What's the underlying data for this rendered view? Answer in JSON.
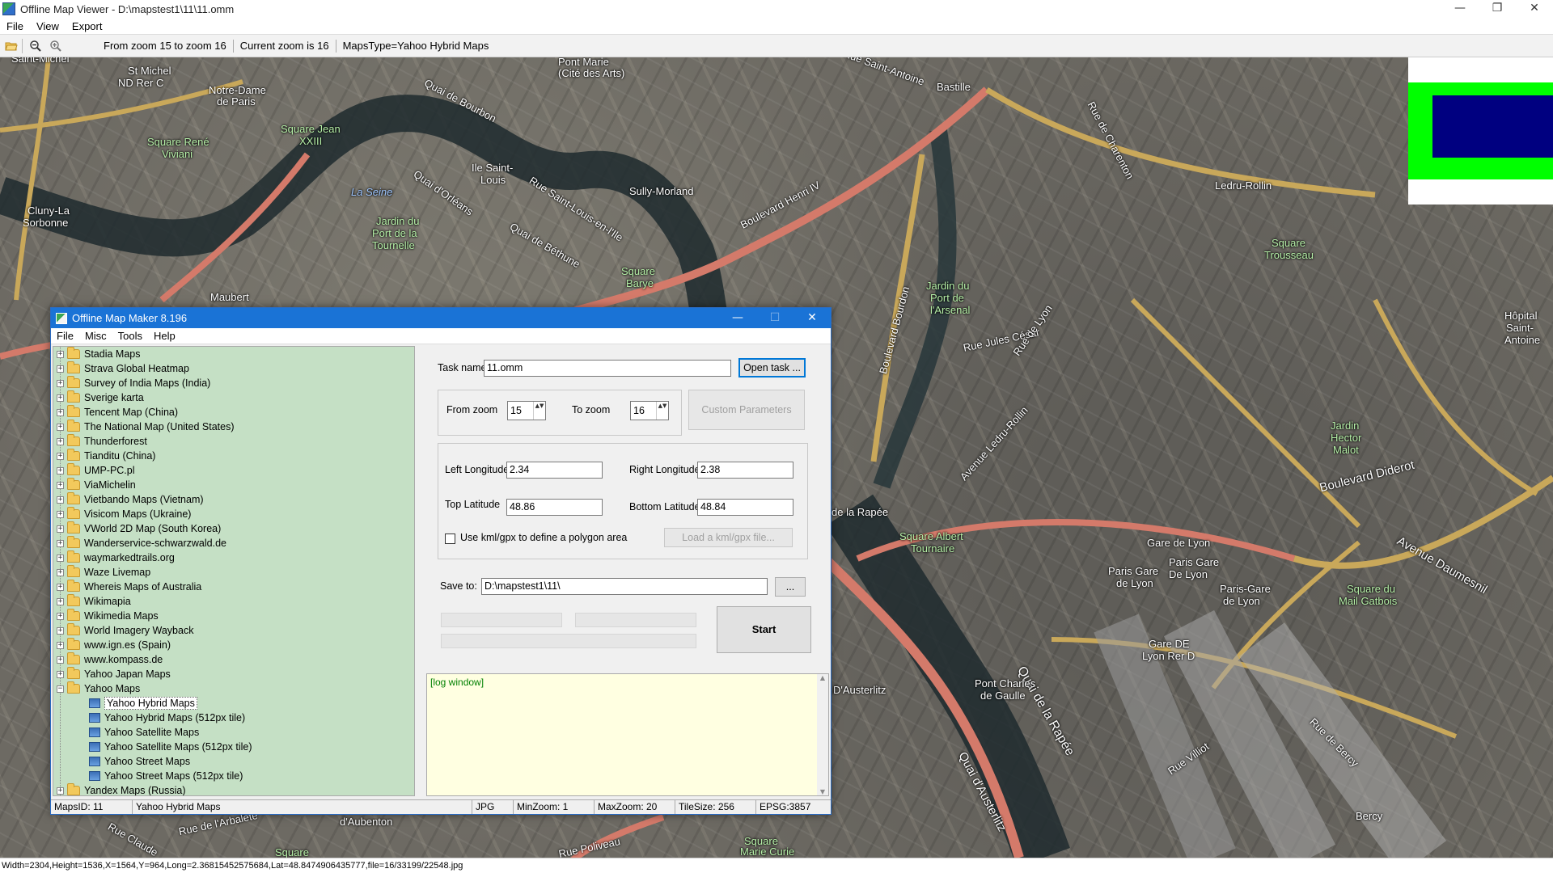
{
  "window": {
    "title": "Offline Map Viewer - D:\\mapstest1\\11\\11.omm",
    "controls": {
      "minimize": "—",
      "maximize": "❐",
      "close": "✕"
    }
  },
  "menu": [
    "File",
    "View",
    "Export"
  ],
  "toolbar": {
    "icons": [
      "open-folder-icon",
      "zoom-out-icon",
      "zoom-in-icon"
    ],
    "zoom_range": "From zoom 15 to zoom 16",
    "current_zoom": "Current zoom is 16",
    "maps_type": "MapsType=Yahoo Hybrid Maps"
  },
  "map_labels": [
    {
      "text": "Saint-Michel"
    },
    {
      "text": "St Michel"
    },
    {
      "text": "ND Rer C"
    },
    {
      "text": "Notre-Dame"
    },
    {
      "text": "de Paris"
    },
    {
      "text": "Square René"
    },
    {
      "text": "Viviani"
    },
    {
      "text": "Square Jean"
    },
    {
      "text": "XXIII"
    },
    {
      "text": "La Seine"
    },
    {
      "text": "Ile Saint-"
    },
    {
      "text": "Louis"
    },
    {
      "text": "Quai de Bourbon"
    },
    {
      "text": "Quai d'Orléans"
    },
    {
      "text": "Rue Saint-Louis-en-l'Ile"
    },
    {
      "text": "Pont Marie"
    },
    {
      "text": "(Cité des Arts)"
    },
    {
      "text": "Sully-Morland"
    },
    {
      "text": "Jardin du"
    },
    {
      "text": "Port de la"
    },
    {
      "text": "Tournelle"
    },
    {
      "text": "Quai de Béthune"
    },
    {
      "text": "Square"
    },
    {
      "text": "Barye"
    },
    {
      "text": "Cluny-La"
    },
    {
      "text": "Sorbonne"
    },
    {
      "text": "Maubert"
    },
    {
      "text": "Boulevard Henri IV"
    },
    {
      "text": "Bastille"
    },
    {
      "text": "Rue Saint-Antoine"
    },
    {
      "text": "Boulevard Bourdon"
    },
    {
      "text": "Jardin du"
    },
    {
      "text": "Port de"
    },
    {
      "text": "l'Arsenal"
    },
    {
      "text": "Rue Jules César"
    },
    {
      "text": "Rue de Lyon"
    },
    {
      "text": "Ledru-Rollin"
    },
    {
      "text": "Square"
    },
    {
      "text": "Trousseau"
    },
    {
      "text": "Rue de Charenton"
    },
    {
      "text": "Hôpital"
    },
    {
      "text": "Saint-"
    },
    {
      "text": "Antoine"
    },
    {
      "text": "Jardin"
    },
    {
      "text": "Hector"
    },
    {
      "text": "Malot"
    },
    {
      "text": "Boulevard Diderot"
    },
    {
      "text": "Avenue Ledru-Rollin"
    },
    {
      "text": "Avenue Daumesnil"
    },
    {
      "text": "Gare de Lyon"
    },
    {
      "text": "Paris Gare"
    },
    {
      "text": "de Lyon"
    },
    {
      "text": "Paris Gare"
    },
    {
      "text": "De Lyon"
    },
    {
      "text": "Paris-Gare"
    },
    {
      "text": "de Lyon"
    },
    {
      "text": "Square du"
    },
    {
      "text": "Mail Gatbois"
    },
    {
      "text": "Gare DE"
    },
    {
      "text": "Lyon Rer D"
    },
    {
      "text": "Quai de la Rapée"
    },
    {
      "text": "de la Rapée"
    },
    {
      "text": "Square Albert"
    },
    {
      "text": "Tournaire"
    },
    {
      "text": "D'Austerlitz"
    },
    {
      "text": "Pont Charles"
    },
    {
      "text": "de Gaulle"
    },
    {
      "text": "Quai d'Austerlitz"
    },
    {
      "text": "Rue de Bercy"
    },
    {
      "text": "Rue Villiot"
    },
    {
      "text": "Bercy"
    },
    {
      "text": "Rue Poliveau"
    },
    {
      "text": "Square"
    },
    {
      "text": "Marie Curie"
    },
    {
      "text": "Rue de l'Arbalète"
    },
    {
      "text": "Rue Claude"
    },
    {
      "text": "d'Aubenton"
    },
    {
      "text": "Square"
    }
  ],
  "statusbar": "Width=2304,Height=1536,X=1564,Y=964,Long=2.36815452575684,Lat=48.8474906435777,file=16/33199/22548.jpg",
  "dialog": {
    "title": "Offline Map Maker 8.196",
    "controls": {
      "minimize": "—",
      "maximize": "☐",
      "close": "✕"
    },
    "menu": [
      "File",
      "Misc",
      "Tools",
      "Help"
    ],
    "tree": {
      "folders": [
        "Stadia Maps",
        "Strava Global Heatmap",
        "Survey of India Maps (India)",
        "Sverige karta",
        "Tencent Map (China)",
        "The National Map (United States)",
        "Thunderforest",
        "Tianditu (China)",
        "UMP-PC.pl",
        "ViaMichelin",
        "Vietbando Maps (Vietnam)",
        "Visicom Maps (Ukraine)",
        "VWorld 2D Map (South Korea)",
        "Wanderservice-schwarzwald.de",
        "waymarkedtrails.org",
        "Waze Livemap",
        "Whereis Maps of Australia",
        "Wikimapia",
        "Wikimedia Maps",
        "World Imagery Wayback",
        "www.ign.es (Spain)",
        "www.kompass.de",
        "Yahoo Japan Maps"
      ],
      "expanded_folder": "Yahoo Maps",
      "children": [
        "Yahoo Hybrid Maps",
        "Yahoo Hybrid Maps (512px tile)",
        "Yahoo Satellite Maps",
        "Yahoo Satellite Maps (512px tile)",
        "Yahoo Street Maps",
        "Yahoo Street Maps (512px tile)"
      ],
      "selected_child": "Yahoo Hybrid Maps",
      "last_folder": "Yandex Maps (Russia)",
      "expander_plus": "+",
      "expander_minus": "−"
    },
    "form": {
      "task_name_label": "Task name",
      "task_name_value": "11.omm",
      "open_task": "Open task ...",
      "from_zoom_label": "From zoom",
      "from_zoom_value": "15",
      "to_zoom_label": "To zoom",
      "to_zoom_value": "16",
      "custom_params": "Custom Parameters",
      "left_lon_label": "Left Longitude",
      "left_lon_value": "2.34",
      "right_lon_label": "Right Longitude",
      "right_lon_value": "2.38",
      "top_lat_label": "Top Latitude",
      "top_lat_value": "48.86",
      "bottom_lat_label": "Bottom Latitude",
      "bottom_lat_value": "48.84",
      "use_kml_label": "Use kml/gpx to define a polygon area",
      "load_kml": "Load a kml/gpx file...",
      "save_to_label": "Save to:",
      "save_to_value": "D:\\mapstest1\\11\\",
      "browse": "...",
      "start": "Start",
      "spin_arrows": "▲▼"
    },
    "log": "[log window]",
    "scroll_up": "▲",
    "scroll_down": "▼",
    "status": {
      "maps_id": "MapsID: 11",
      "maps_name": "Yahoo Hybrid Maps",
      "format": "JPG",
      "min_zoom": "MinZoom: 1",
      "max_zoom": "MaxZoom: 20",
      "tile_size": "TileSize: 256",
      "epsg": "EPSG:3857"
    }
  }
}
